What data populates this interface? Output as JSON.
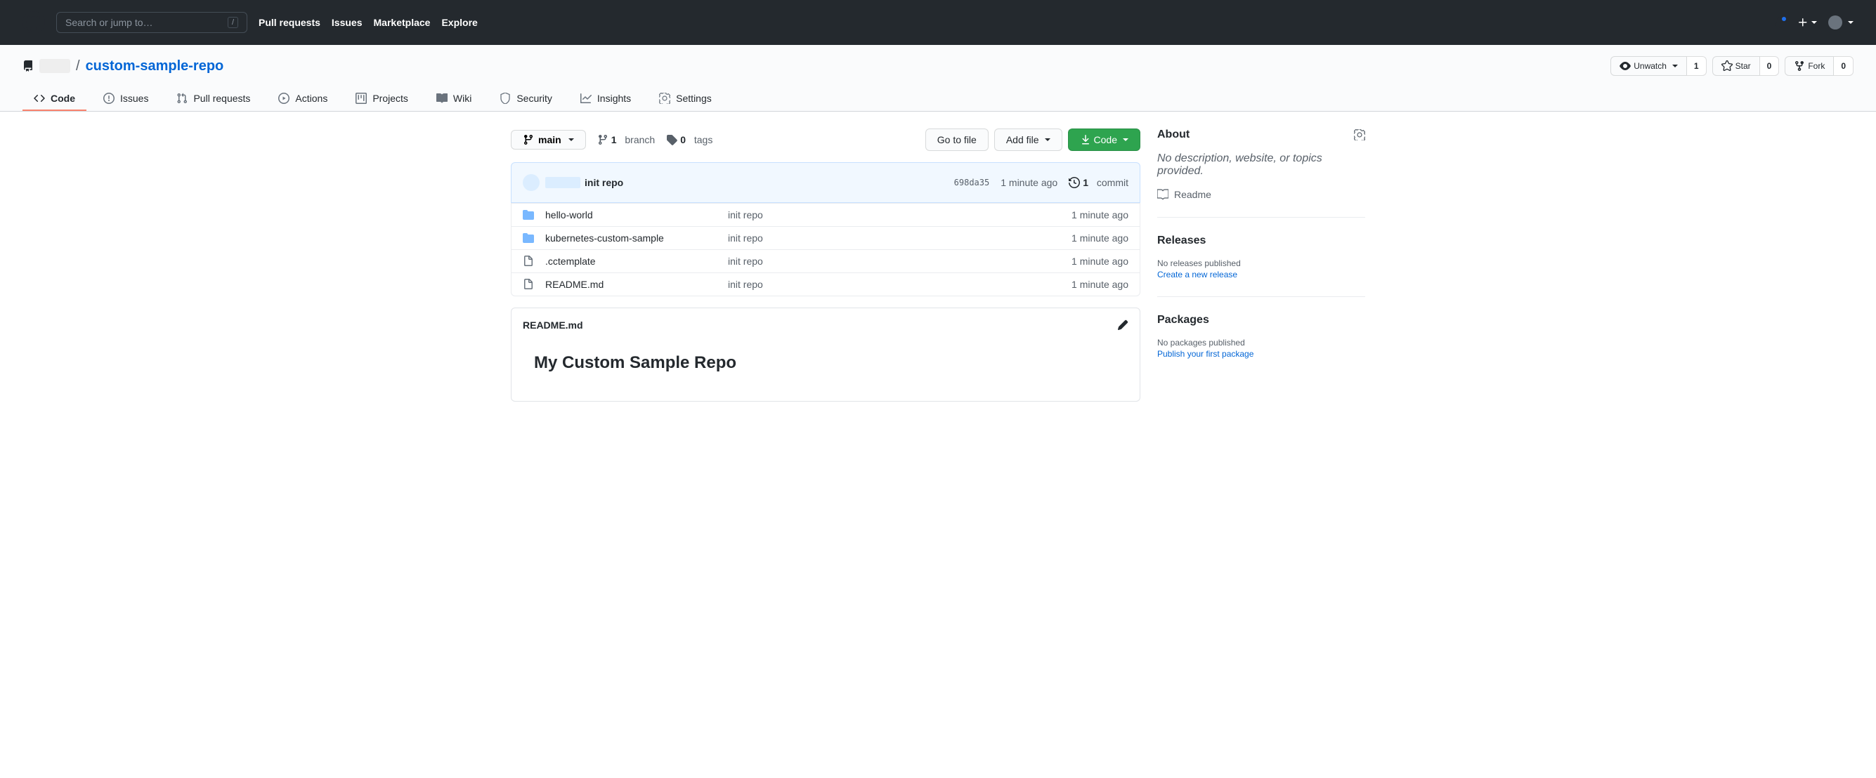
{
  "header": {
    "search_placeholder": "Search or jump to…",
    "slash": "/",
    "nav": {
      "pull_requests": "Pull requests",
      "issues": "Issues",
      "marketplace": "Marketplace",
      "explore": "Explore"
    }
  },
  "repo": {
    "separator": "/",
    "name": "custom-sample-repo",
    "actions": {
      "unwatch": "Unwatch",
      "watch_count": "1",
      "star": "Star",
      "star_count": "0",
      "fork": "Fork",
      "fork_count": "0"
    },
    "tabs": {
      "code": "Code",
      "issues": "Issues",
      "pull_requests": "Pull requests",
      "actions": "Actions",
      "projects": "Projects",
      "wiki": "Wiki",
      "security": "Security",
      "insights": "Insights",
      "settings": "Settings"
    }
  },
  "file_nav": {
    "branch": "main",
    "branch_count": "1",
    "branch_label": "branch",
    "tag_count": "0",
    "tag_label": "tags",
    "go_to_file": "Go to file",
    "add_file": "Add file",
    "code_btn": "Code"
  },
  "commit": {
    "message": "init repo",
    "sha": "698da35",
    "time": "1 minute ago",
    "count": "1",
    "count_label": "commit"
  },
  "files": [
    {
      "type": "dir",
      "name": "hello-world",
      "msg": "init repo",
      "time": "1 minute ago"
    },
    {
      "type": "dir",
      "name": "kubernetes-custom-sample",
      "msg": "init repo",
      "time": "1 minute ago"
    },
    {
      "type": "file",
      "name": ".cctemplate",
      "msg": "init repo",
      "time": "1 minute ago"
    },
    {
      "type": "file",
      "name": "README.md",
      "msg": "init repo",
      "time": "1 minute ago"
    }
  ],
  "readme": {
    "filename": "README.md",
    "heading": "My Custom Sample Repo"
  },
  "sidebar": {
    "about": {
      "title": "About",
      "desc": "No description, website, or topics provided.",
      "readme": "Readme"
    },
    "releases": {
      "title": "Releases",
      "none": "No releases published",
      "create": "Create a new release"
    },
    "packages": {
      "title": "Packages",
      "none": "No packages published",
      "publish": "Publish your first package"
    }
  }
}
